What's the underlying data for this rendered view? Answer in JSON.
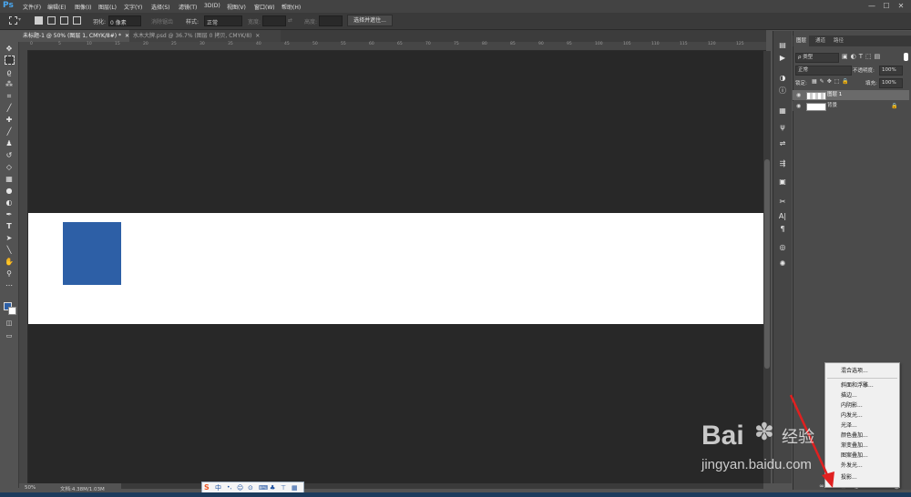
{
  "app": {
    "logo": "Ps"
  },
  "menubar": {
    "items": [
      "文件(F)",
      "编辑(E)",
      "图像(I)",
      "图层(L)",
      "文字(Y)",
      "选择(S)",
      "滤镜(T)",
      "3D(D)",
      "视图(V)",
      "窗口(W)",
      "帮助(H)"
    ],
    "window_buttons": [
      "—",
      "☐",
      "✕"
    ]
  },
  "options_bar": {
    "feather_label": "羽化:",
    "feather_value": "0 像素",
    "antialias_label": "消除锯齿",
    "style_label": "样式:",
    "style_value": "正常",
    "width_label": "宽度:",
    "height_label": "高度:",
    "select_mask_button": "选择并遮住..."
  },
  "tabs": [
    {
      "label": "未标题-1 @ 50% (图层 1, CMYK/8#) *",
      "close": "✕"
    },
    {
      "label": "水木大牌.psd @ 36.7% (图层 0 拷贝, CMYK/8)",
      "close": "✕"
    }
  ],
  "ruler": {
    "top_labels": [
      "0",
      "5",
      "10",
      "15",
      "20",
      "25",
      "30",
      "35",
      "40",
      "45",
      "50",
      "55",
      "60",
      "65",
      "70",
      "75",
      "80",
      "85",
      "90",
      "95",
      "100",
      "105",
      "110",
      "115",
      "120",
      "125"
    ]
  },
  "status": {
    "zoom": "50%",
    "doc": "文档:4.38M/1.03M"
  },
  "ime": {
    "logo": "S",
    "lang": "中"
  },
  "colors": {
    "doc_bg": "#ffffff",
    "canvas_bg": "#282828",
    "shape": "#2d5fa6",
    "accent_arrow": "#e02020"
  },
  "layers_panel": {
    "tabs": [
      "图层",
      "通道",
      "路径"
    ],
    "filter_value": "ρ 类型",
    "blend_mode": "正常",
    "opacity_label": "不透明度:",
    "opacity_value": "100%",
    "lock_label": "锁定:",
    "fill_label": "填充:",
    "fill_value": "100%",
    "layers": [
      {
        "name": "图层 1",
        "selected": true
      },
      {
        "name": "背景",
        "locked": true
      }
    ]
  },
  "context_menu": {
    "items": [
      "混合选项...",
      "斜面和浮雕...",
      "描边...",
      "内阴影...",
      "内发光...",
      "光泽...",
      "颜色叠加...",
      "渐变叠加...",
      "图案叠加...",
      "外发光...",
      "投影..."
    ]
  },
  "watermark": {
    "brand": "Bai",
    "brand2": "经验",
    "url": "jingyan.baidu.com"
  }
}
